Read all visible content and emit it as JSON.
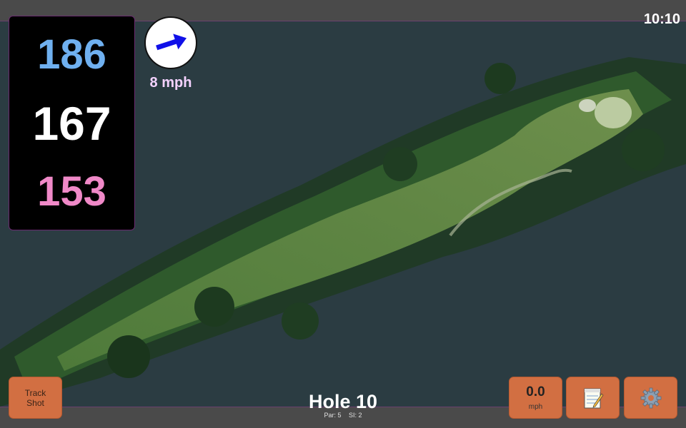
{
  "status": {
    "time": "10:10"
  },
  "distances": {
    "back": "186",
    "center": "167",
    "front": "153"
  },
  "wind": {
    "speed": "8 mph",
    "icon": "wind-direction-arrow-icon"
  },
  "hole": {
    "title": "Hole 10",
    "par": "Par: 5",
    "si": "SI: 2"
  },
  "buttons": {
    "track_shot": {
      "line1": "Track",
      "line2": "Shot"
    },
    "speed": {
      "value": "0.0",
      "unit": "mph"
    },
    "notes_icon": "notepad-icon",
    "settings_icon": "gear-icon"
  },
  "colors": {
    "back": "#6fb0f0",
    "center": "#ffffff",
    "front": "#f089c8",
    "button": "#d26f42",
    "bar": "#4a4a4a"
  }
}
